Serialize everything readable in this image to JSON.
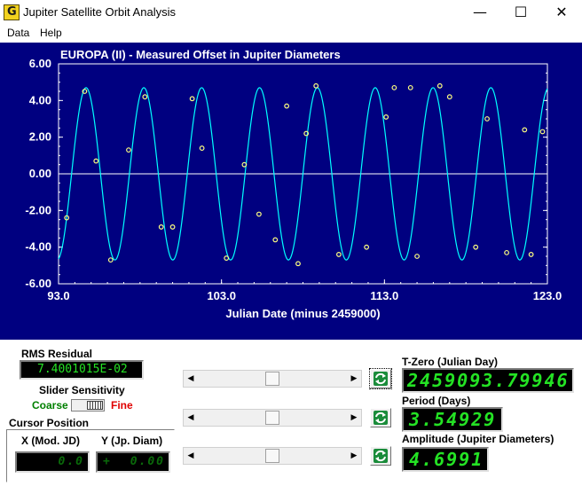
{
  "window": {
    "title": "Jupiter Satellite Orbit Analysis",
    "icon_name": "orbit-app-icon",
    "minimize_glyph": "—",
    "maximize_glyph": "☐",
    "close_glyph": "✕"
  },
  "menu": {
    "items": [
      {
        "label": "Data"
      },
      {
        "label": "Help"
      }
    ]
  },
  "chart_data": {
    "type": "scatter",
    "title": "EUROPA (II) - Measured Offset in Jupiter Diameters",
    "xlabel": "Julian Date (minus 2459000)",
    "ylabel": "",
    "xlim": [
      93.0,
      123.0
    ],
    "ylim": [
      -6.0,
      6.0
    ],
    "x_ticks": [
      93.0,
      103.0,
      113.0,
      123.0
    ],
    "x_tick_labels": [
      "93.0",
      "103.0",
      "113.0",
      "123.0"
    ],
    "y_ticks": [
      6.0,
      4.0,
      2.0,
      0.0,
      -2.0,
      -4.0,
      -6.0
    ],
    "y_tick_labels": [
      "6.00",
      "4.00",
      "2.00",
      "0.00",
      "-2.00",
      "-4.00",
      "-6.00"
    ],
    "colors": {
      "background": "#000080",
      "curve": "#00ffff",
      "points": "#ffff80",
      "text": "#ffffff"
    },
    "fit_curve": {
      "amplitude": 4.6991,
      "period_days": 3.54929,
      "t_zero": 93.79946,
      "x_start": 93.0,
      "x_end": 123.0
    },
    "series": [
      {
        "x": [
          93.5,
          94.6,
          95.3,
          96.2,
          97.3,
          98.3,
          99.3,
          100.0,
          101.2,
          101.8,
          103.3,
          104.4,
          105.3,
          106.3,
          107.0,
          107.7,
          108.2,
          108.8,
          110.2,
          111.9,
          113.1,
          113.6,
          114.6,
          115.0,
          116.4,
          117.0,
          118.6,
          119.3,
          120.5,
          121.6,
          122.0,
          122.7
        ],
        "y": [
          -2.4,
          4.5,
          0.7,
          -4.7,
          1.3,
          4.2,
          -2.9,
          -2.9,
          4.1,
          1.4,
          -4.6,
          0.5,
          -2.2,
          -3.6,
          3.7,
          -4.9,
          2.2,
          4.8,
          -4.4,
          -4.0,
          3.1,
          4.7,
          4.7,
          -4.5,
          4.8,
          4.2,
          -4.0,
          3.0,
          -4.3,
          2.4,
          -4.4,
          2.3
        ]
      }
    ]
  },
  "lower_panel": {
    "rms_label": "RMS Residual",
    "rms_value": "7.4001015E-02",
    "sensitivity_label": "Slider Sensitivity",
    "sensitivity_coarse": "Coarse",
    "sensitivity_fine": "Fine",
    "cursor_label": "Cursor Position",
    "cursor_x_label": "X (Mod. JD)",
    "cursor_y_label": "Y (Jp. Diam)",
    "cursor_x_value": "0.0",
    "cursor_y_value": "0.00",
    "cursor_y_sign": "+",
    "sliders": [
      {
        "name": "t-zero",
        "position": 0.5
      },
      {
        "name": "period",
        "position": 0.5
      },
      {
        "name": "amplitude",
        "position": 0.5
      }
    ],
    "tzero_label": "T-Zero (Julian Day)",
    "tzero_value": "2459093.79946",
    "period_label": "Period (Days)",
    "period_value": "3.54929",
    "amplitude_label": "Amplitude (Jupiter Diameters)",
    "amplitude_value": "4.6991",
    "refresh_icon_name": "refresh-icon"
  }
}
